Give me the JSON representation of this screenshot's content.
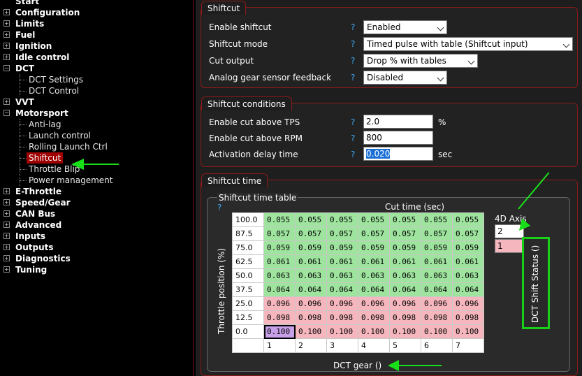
{
  "tree": {
    "items": [
      {
        "label": "Start",
        "level": 0
      },
      {
        "label": "Configuration",
        "level": 0
      },
      {
        "label": "Limits",
        "level": 0
      },
      {
        "label": "Fuel",
        "level": 0
      },
      {
        "label": "Ignition",
        "level": 0
      },
      {
        "label": "Idle control",
        "level": 0
      },
      {
        "label": "DCT",
        "level": 0
      },
      {
        "label": "DCT Settings",
        "level": 1
      },
      {
        "label": "DCT Control",
        "level": 1
      },
      {
        "label": "VVT",
        "level": 0
      },
      {
        "label": "Motorsport",
        "level": 0
      },
      {
        "label": "Anti-lag",
        "level": 1
      },
      {
        "label": "Launch control",
        "level": 1
      },
      {
        "label": "Rolling Launch Ctrl",
        "level": 1
      },
      {
        "label": "Shiftcut",
        "level": 1
      },
      {
        "label": "Throttle Blip",
        "level": 1
      },
      {
        "label": "Power management",
        "level": 1
      },
      {
        "label": "E-Throttle",
        "level": 0
      },
      {
        "label": "Speed/Gear",
        "level": 0
      },
      {
        "label": "CAN Bus",
        "level": 0
      },
      {
        "label": "Advanced",
        "level": 0
      },
      {
        "label": "Inputs",
        "level": 0
      },
      {
        "label": "Outputs",
        "level": 0
      },
      {
        "label": "Diagnostics",
        "level": 0
      },
      {
        "label": "Tuning",
        "level": 0
      }
    ],
    "expander_plus": "+",
    "expander_minus": "−"
  },
  "shiftcut": {
    "title": "Shiftcut",
    "rows": [
      {
        "label": "Enable shiftcut",
        "value": "Enabled"
      },
      {
        "label": "Shiftcut mode",
        "value": "Timed pulse with table (Shiftcut input)"
      },
      {
        "label": "Cut output",
        "value": "Drop % with tables"
      },
      {
        "label": "Analog gear sensor feedback",
        "value": "Disabled"
      }
    ]
  },
  "conditions": {
    "title": "Shiftcut conditions",
    "rows": [
      {
        "label": "Enable cut above TPS",
        "value": "2.0",
        "unit": "%"
      },
      {
        "label": "Enable cut above RPM",
        "value": "800",
        "unit": ""
      },
      {
        "label": "Activation delay time",
        "value": "0.020",
        "unit": "sec"
      }
    ]
  },
  "help_mark": "?",
  "time": {
    "title": "Shiftcut time",
    "table_title": "Shiftcut time table",
    "col_title": "Cut time (sec)",
    "y_label": "Throttle position (%)",
    "x_label": "DCT gear ()",
    "axis4d_label": "4D Axis",
    "axis4d_value": "2",
    "axis4d_value2": "1",
    "axis4d_name": "DCT Shift Status ()",
    "y": [
      "100.0",
      "87.5",
      "75.0",
      "62.5",
      "50.0",
      "37.5",
      "25.0",
      "12.5",
      "0.0"
    ],
    "x": [
      "1",
      "2",
      "3",
      "4",
      "5",
      "6",
      "7"
    ],
    "values": [
      [
        "0.055",
        "0.055",
        "0.055",
        "0.055",
        "0.055",
        "0.055",
        "0.055"
      ],
      [
        "0.057",
        "0.057",
        "0.057",
        "0.057",
        "0.057",
        "0.057",
        "0.057"
      ],
      [
        "0.059",
        "0.059",
        "0.059",
        "0.059",
        "0.059",
        "0.059",
        "0.059"
      ],
      [
        "0.061",
        "0.061",
        "0.061",
        "0.061",
        "0.061",
        "0.061",
        "0.061"
      ],
      [
        "0.063",
        "0.063",
        "0.063",
        "0.063",
        "0.063",
        "0.063",
        "0.063"
      ],
      [
        "0.064",
        "0.064",
        "0.064",
        "0.064",
        "0.064",
        "0.064",
        "0.064"
      ],
      [
        "0.096",
        "0.096",
        "0.096",
        "0.096",
        "0.096",
        "0.096",
        "0.096"
      ],
      [
        "0.098",
        "0.098",
        "0.098",
        "0.098",
        "0.098",
        "0.098",
        "0.098"
      ],
      [
        "0.100",
        "0.100",
        "0.100",
        "0.100",
        "0.100",
        "0.100",
        "0.100"
      ]
    ]
  },
  "colors": {
    "green_cell": "#9ee39e",
    "red_cell": "#f5b6bd",
    "selected_tree": "#a00000",
    "help": "#3fa9f5",
    "annotation": "#18d018"
  }
}
